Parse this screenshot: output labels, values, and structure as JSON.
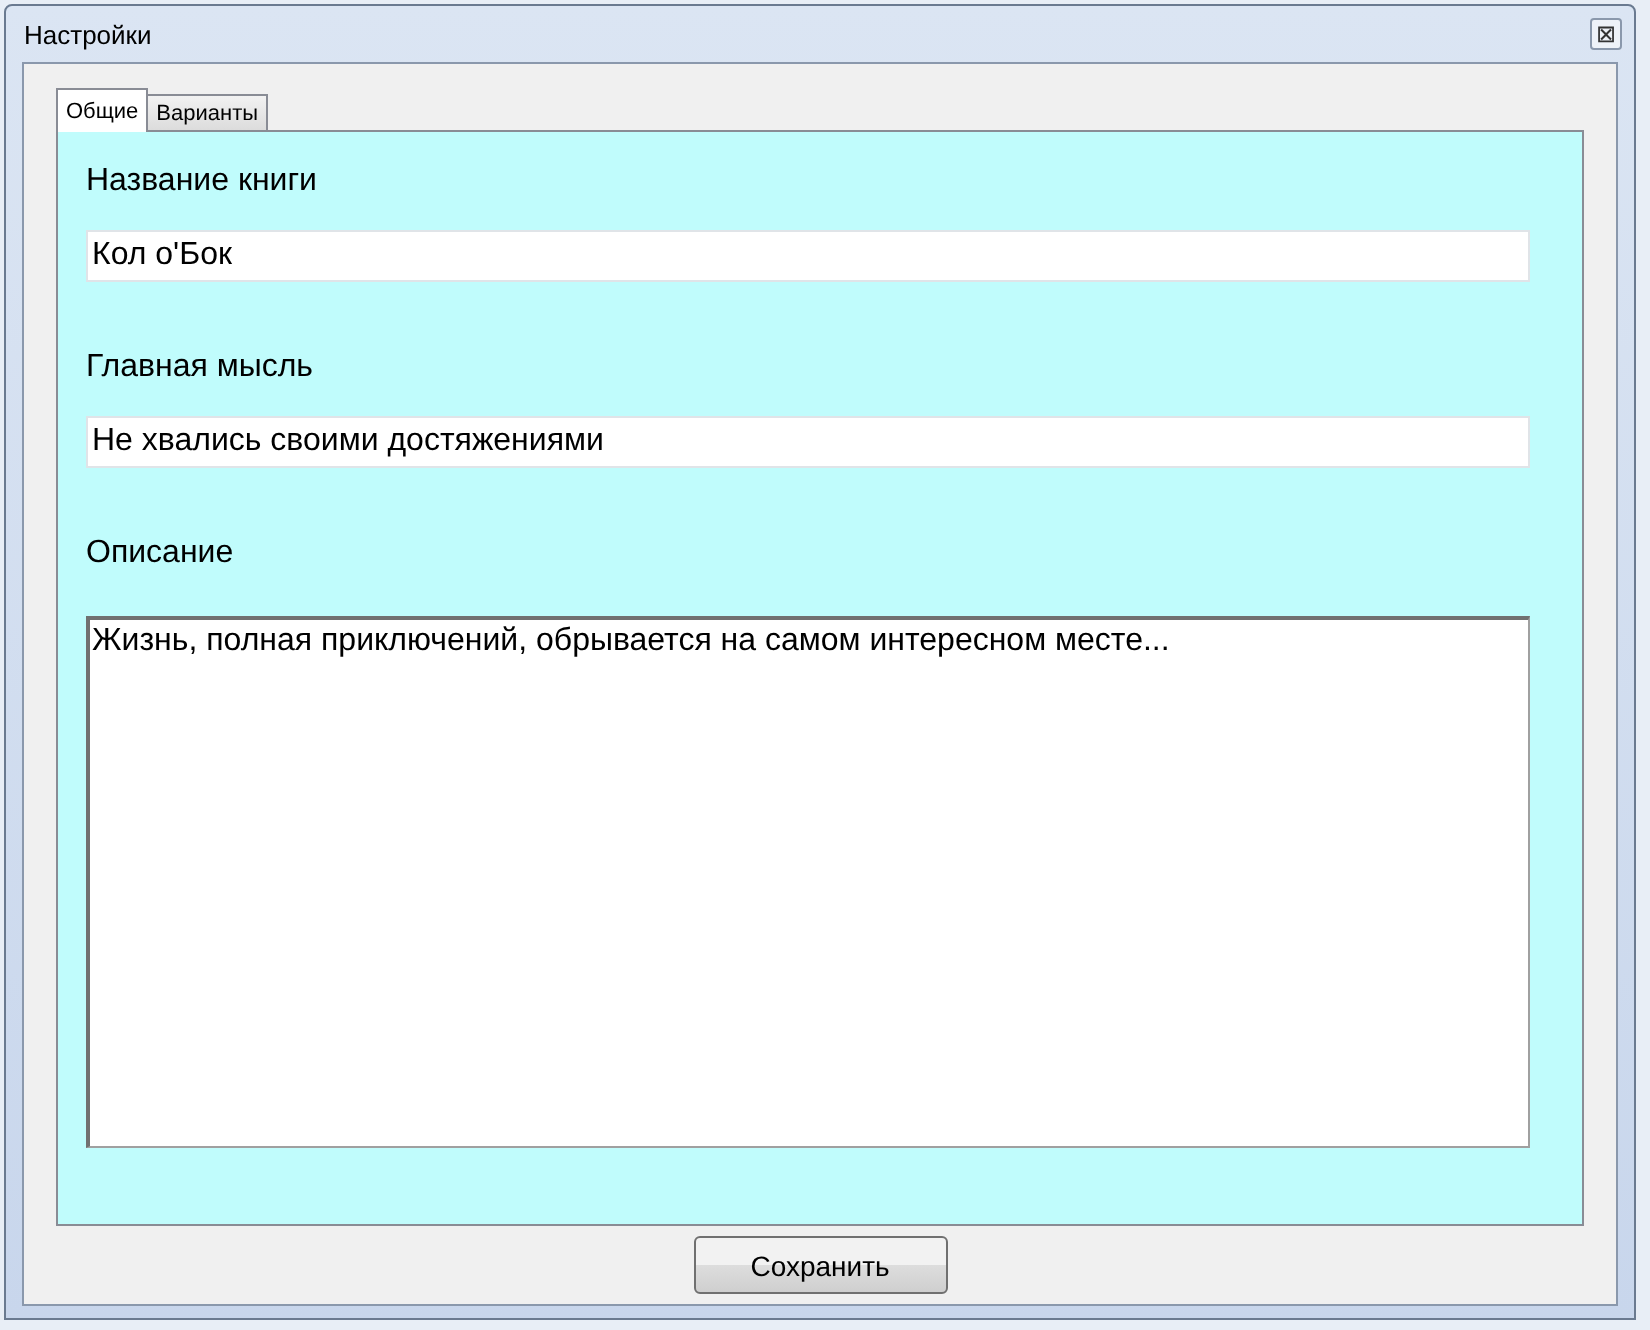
{
  "window": {
    "title": "Настройки",
    "close": "⊠"
  },
  "tabs": [
    {
      "label": "Общие",
      "selected": true
    },
    {
      "label": "Варианты",
      "selected": false
    }
  ],
  "fields": [
    {
      "label": "Название книги",
      "value": "Кол о'Бок",
      "kind": "line"
    },
    {
      "label": "Главная мысль",
      "value": "Не хвались своими достяжениями",
      "kind": "line"
    },
    {
      "label": "Описание",
      "value": "Жизнь, полная приключений, обрывается на самом интересном месте...",
      "kind": "area"
    }
  ],
  "buttons": [
    "Сохранить"
  ]
}
